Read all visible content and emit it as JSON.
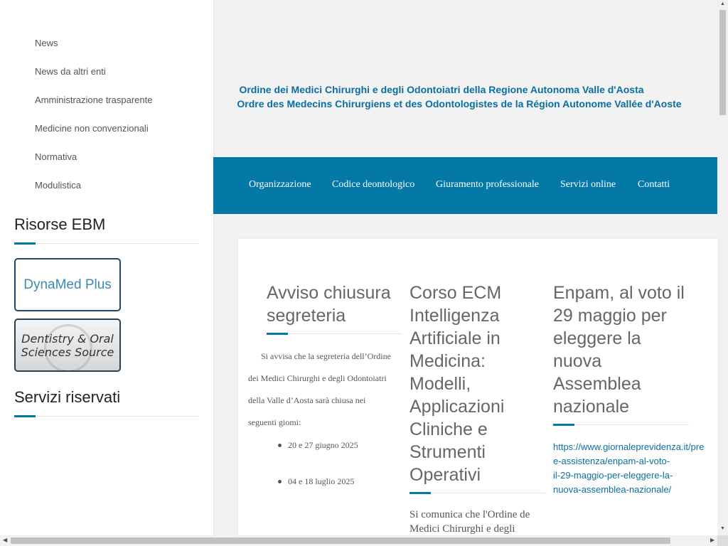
{
  "sidebar": {
    "menu": [
      {
        "icon": "chevron-right-icon",
        "label": "News"
      },
      {
        "icon": "chevron-right-icon",
        "label": "News da altri enti"
      },
      {
        "icon": "chevron-right-icon",
        "label": "Amministrazione trasparente"
      },
      {
        "icon": "chevron-right-icon",
        "label": "Medicine non convenzionali"
      },
      {
        "icon": "chevron-right-icon",
        "label": "Normativa"
      },
      {
        "icon": "chevron-right-icon",
        "label": "Modulistica"
      }
    ],
    "menu_icon_glyph": "",
    "resources_title": "Risorse EBM",
    "banners": {
      "dynamed": "DynaMed Plus",
      "dentistry_line1": "Dentistry & Oral",
      "dentistry_line2": "Sciences Source"
    },
    "reserved_title": "Servizi riservati"
  },
  "header": {
    "title_it": "Ordine dei Medici Chirurghi e degli Odontoiatri della Regione Autonoma Valle d'Aosta",
    "title_fr": "Ordre des Medecins Chirurgiens et des Odontologistes de la Région Autonome Vallée d'Aoste"
  },
  "nav": [
    "Organizzazione",
    "Codice deontologico",
    "Giuramento professionale",
    "Servizi online",
    "Contatti"
  ],
  "posts": [
    {
      "title_lines": [
        "Avviso chiusura",
        "segreteria"
      ],
      "body_lines": [
        "Si avvisa che la segreteria dell’Ordine",
        "dei Medici Chirurghi e degli Odontoiatri",
        "della Valle d’Aosta sarà chiusa nei",
        "seguenti giomi:"
      ],
      "bullets": [
        "20 e 27 giugno 2025",
        "04 e 18 luglio 2025"
      ]
    },
    {
      "title_lines": [
        "Corso ECM",
        "Intelligenza",
        "Artificiale in",
        "Medicina:",
        "Modelli,",
        "Applicazioni",
        "Cliniche e",
        "Strumenti",
        "Operativi"
      ],
      "body_lines": [
        "Si comunica che l'Ordine de",
        "Medici Chirurghi e degli"
      ]
    },
    {
      "title_lines": [
        "Enpam, al voto il",
        "29 maggio per",
        "eleggere la",
        "nuova",
        "Assemblea",
        "nazionale"
      ],
      "link_lines": [
        "https://www.giornaleprevidenza.it/pre",
        "e-assistenza/enpam-al-voto-",
        "il-29-maggio-per-eleggere-la-",
        "nuova-assemblea-nazionale/"
      ]
    }
  ],
  "colors": {
    "accent": "#0478a6",
    "title_text": "#0a6fa0"
  }
}
